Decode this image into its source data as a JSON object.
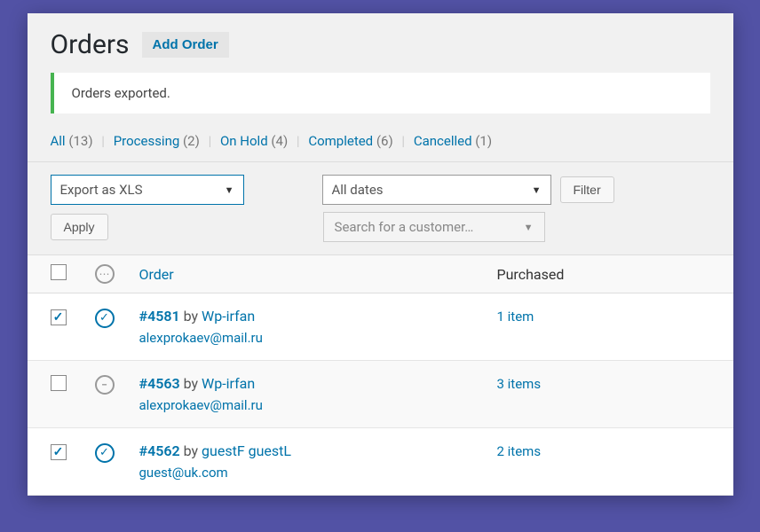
{
  "header": {
    "title": "Orders",
    "add_order": "Add Order"
  },
  "notice": "Orders exported.",
  "filters": {
    "all": {
      "label": "All",
      "count": "(13)"
    },
    "processing": {
      "label": "Processing",
      "count": "(2)"
    },
    "onhold": {
      "label": "On Hold",
      "count": "(4)"
    },
    "completed": {
      "label": "Completed",
      "count": "(6)"
    },
    "cancelled": {
      "label": "Cancelled",
      "count": "(1)"
    }
  },
  "controls": {
    "export_select": "Export as XLS",
    "dates_select": "All dates",
    "filter_btn": "Filter",
    "apply_btn": "Apply",
    "customer_search": "Search for a customer…"
  },
  "columns": {
    "order": "Order",
    "purchased": "Purchased"
  },
  "rows": [
    {
      "checked": true,
      "status": "processing",
      "id": "#4581",
      "by": " by ",
      "customer": "Wp-irfan",
      "email": "alexprokaev@mail.ru",
      "purchased": "1 item"
    },
    {
      "checked": false,
      "status": "onhold",
      "id": "#4563",
      "by": " by ",
      "customer": "Wp-irfan",
      "email": "alexprokaev@mail.ru",
      "purchased": "3 items"
    },
    {
      "checked": true,
      "status": "processing",
      "id": "#4562",
      "by": " by ",
      "customer": "guestF guestL",
      "email": "guest@uk.com",
      "purchased": "2 items"
    }
  ]
}
